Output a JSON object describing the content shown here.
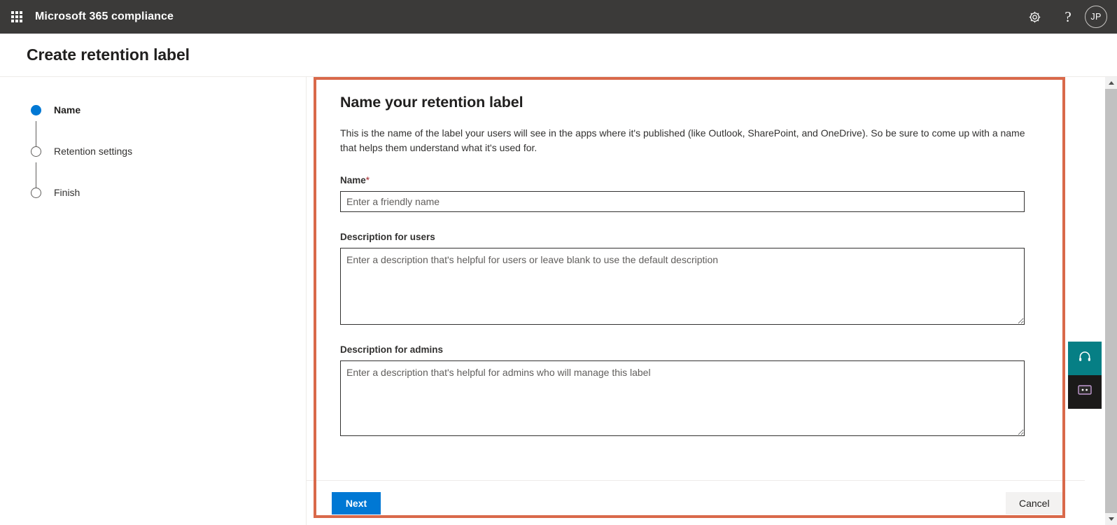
{
  "suite_bar": {
    "waffle_label": "App launcher",
    "title": "Microsoft 365 compliance",
    "settings_icon": "gear-icon",
    "help_icon": "question-mark-icon",
    "avatar_initials": "JP"
  },
  "page": {
    "title": "Create retention label"
  },
  "wizard": {
    "steps": [
      {
        "label": "Name",
        "state": "active"
      },
      {
        "label": "Retention settings",
        "state": "inactive"
      },
      {
        "label": "Finish",
        "state": "inactive"
      }
    ]
  },
  "form": {
    "heading": "Name your retention label",
    "intro": "This is the name of the label your users will see in the apps where it's published (like Outlook, SharePoint, and OneDrive). So be sure to come up with a name that helps them understand what it's used for.",
    "name_field": {
      "label": "Name",
      "required_mark": "*",
      "value": "",
      "placeholder": "Enter a friendly name"
    },
    "user_description_field": {
      "label": "Description for users",
      "value": "",
      "placeholder": "Enter a description that's helpful for users or leave blank to use the default description"
    },
    "admin_description_field": {
      "label": "Description for admins",
      "value": "",
      "placeholder": "Enter a description that's helpful for admins who will manage this label"
    }
  },
  "footer": {
    "next_label": "Next",
    "cancel_label": "Cancel"
  },
  "widgets": {
    "support_icon": "headset-icon",
    "feedback_icon": "feedback-chat-icon"
  },
  "colors": {
    "suite_bar": "#3b3a39",
    "accent": "#0078d4",
    "highlight_border": "#d9694a",
    "support_widget": "#067f85",
    "feedback_widget": "#1b1a19",
    "required_asterisk": "#a4262c"
  }
}
